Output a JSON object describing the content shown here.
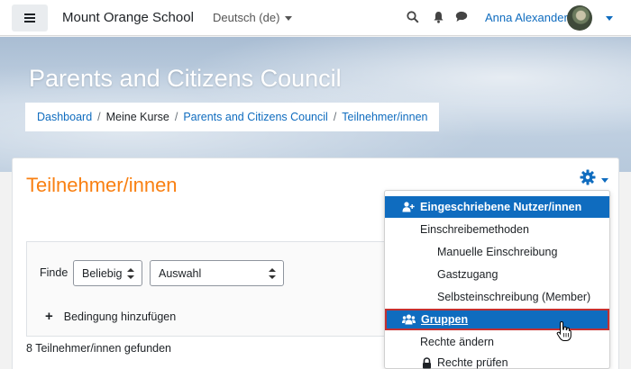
{
  "navbar": {
    "site_name": "Mount Orange School",
    "language": "Deutsch (de)",
    "user_name": "Anna Alexander",
    "icons": [
      "menu-icon",
      "search-icon",
      "bell-icon",
      "chat-icon"
    ]
  },
  "header": {
    "course_title": "Parents and Citizens Council",
    "breadcrumb": {
      "dashboard": "Dashboard",
      "my_courses": "Meine Kurse",
      "course": "Parents and Citizens Council",
      "participants": "Teilnehmer/innen"
    }
  },
  "main": {
    "heading": "Teilnehmer/innen",
    "filter": {
      "label": "Finde",
      "match_value": "Beliebig",
      "type_value": "Auswahl",
      "add_condition": "Bedingung hinzufügen"
    },
    "found_text": "8 Teilnehmer/innen gefunden"
  },
  "dropdown": {
    "items": [
      {
        "label": "Eingeschriebene Nutzer/innen",
        "state": "active"
      },
      {
        "label": "Einschreibemethoden"
      },
      {
        "label": "Manuelle Einschreibung"
      },
      {
        "label": "Gastzugang"
      },
      {
        "label": "Selbsteinschreibung (Member)"
      },
      {
        "label": "Gruppen",
        "state": "hover"
      },
      {
        "label": "Rechte ändern"
      },
      {
        "label": "Rechte prüfen"
      }
    ]
  },
  "colors": {
    "brand_blue": "#0f6cbf",
    "heading_orange": "#f98012",
    "hover_outline": "#c53030"
  }
}
